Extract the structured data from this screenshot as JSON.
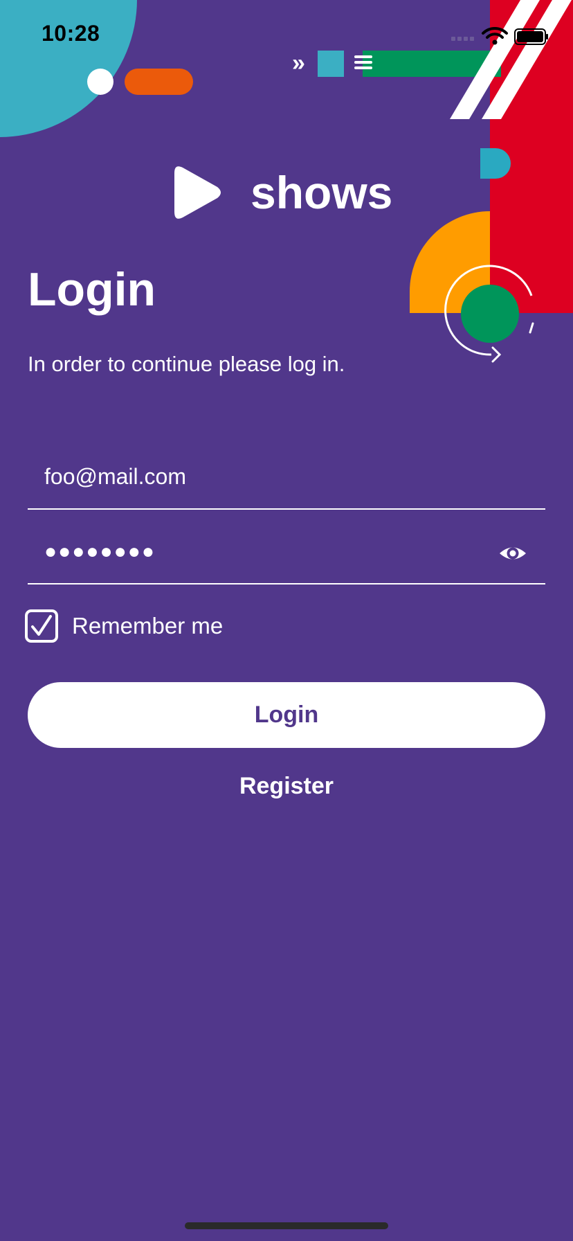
{
  "status_bar": {
    "time": "10:28"
  },
  "logo": {
    "text": "shows",
    "icon": "play-icon"
  },
  "login": {
    "title": "Login",
    "subtitle": "In order to continue please log in.",
    "email_value": "foo@mail.com",
    "password_masked": "●●●●●●●●",
    "remember_label": "Remember me",
    "remember_checked": true,
    "login_label": "Login",
    "register_label": "Register"
  },
  "colors": {
    "background": "#51378B",
    "teal": "#3BAFC3",
    "orange": "#EB5A0B",
    "green": "#00955A",
    "red": "#DD0021",
    "yellow_orange": "#FF9C00",
    "button_bg": "#FFFFFF",
    "button_text": "#51378B"
  },
  "icons": {
    "password_toggle": "eye-icon",
    "checkbox": "checkmark-icon"
  }
}
